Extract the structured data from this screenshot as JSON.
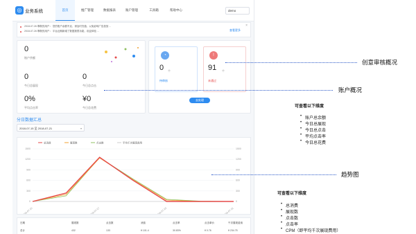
{
  "app": {
    "brand": "业务系统",
    "nav": [
      "首页",
      "推广管理",
      "数据报表",
      "账户管理",
      "工具箱",
      "帮助中心"
    ],
    "active_nav": 0,
    "user": "demo"
  },
  "notice": {
    "rows": [
      "2018-07-26 尊敬的用户：  您的账户余额不足，请及时充值，以免影响广告投放 ...",
      "2018-07-26 尊敬的用户：  平台近期新增了数据报表功能，欢迎体验 ..."
    ],
    "link": "查看更多",
    "close": "×"
  },
  "account": {
    "balance": "0",
    "balance_label": "账户余额",
    "stats": [
      {
        "value": "0",
        "label": "今日总展现"
      },
      {
        "value": "0",
        "label": "今日总点击"
      },
      {
        "value": "0%",
        "label": "平均点击率"
      },
      {
        "value": "¥0",
        "label": "今日总花费"
      }
    ]
  },
  "review": {
    "items": [
      {
        "value": "0",
        "unit": "个",
        "label": "待审核"
      },
      {
        "value": "91",
        "unit": "个",
        "label": "未通过"
      }
    ],
    "button": "去处理"
  },
  "section_title": "分日数据汇总",
  "date_range": "2018-07-15 至 2018-07-21",
  "chart_data": {
    "type": "line",
    "categories": [
      "2018-07-15",
      "2018-07-16",
      "2018-07-17",
      "2018-07-18",
      "2018-07-19",
      "2018-07-20",
      "2018-07-21"
    ],
    "series": [
      {
        "name": "总消费",
        "values": [
          0,
          240,
          1260,
          600,
          0,
          0,
          0
        ]
      },
      {
        "name": "展现数",
        "values": [
          0,
          200,
          1240,
          620,
          40,
          0,
          0
        ]
      },
      {
        "name": "点击数",
        "values": [
          0,
          160,
          1250,
          640,
          60,
          10,
          0
        ]
      },
      {
        "name": "平均千次展现费用",
        "values": [
          0,
          0,
          0,
          0,
          0,
          0,
          0
        ]
      }
    ],
    "colors": [
      "#e64a4a",
      "#f0a030",
      "#8fc060",
      "#cccccc"
    ],
    "ylim_left": [
      0,
      1500
    ],
    "yticks_left": [
      "1500",
      "1200",
      "900",
      "600",
      "300",
      "0"
    ],
    "ylim_right": [
      0,
      1500
    ],
    "yticks_right": [
      "1500",
      "1200",
      "900",
      "600",
      "300",
      "0"
    ],
    "xticks": [
      "2018-07-15",
      "2018-07-17",
      "2018-07-19",
      "2018-07-21"
    ]
  },
  "table": {
    "headers": [
      "日期",
      "展现数",
      "点击数",
      "消费",
      "点击率",
      "点击单价",
      "千次展现费用"
    ],
    "row": [
      "总计",
      "432",
      "133",
      "¥ 101.4",
      "30.83%",
      "¥ 0.76",
      "¥ 234.75"
    ]
  },
  "annotations": {
    "creative": "创意审核概况",
    "account": "账户概况",
    "trend": "趋势图"
  },
  "list1": {
    "title": "可查看以下维度",
    "items": [
      "账户总余额",
      "今日总展现",
      "今日总点击",
      "平均点击率",
      "今日总花费"
    ]
  },
  "list2": {
    "title": "可查看以下维度",
    "items": [
      "总消费",
      "展现数",
      "点击数",
      "点击率",
      "CPM（即平均千次展现费用）"
    ]
  }
}
